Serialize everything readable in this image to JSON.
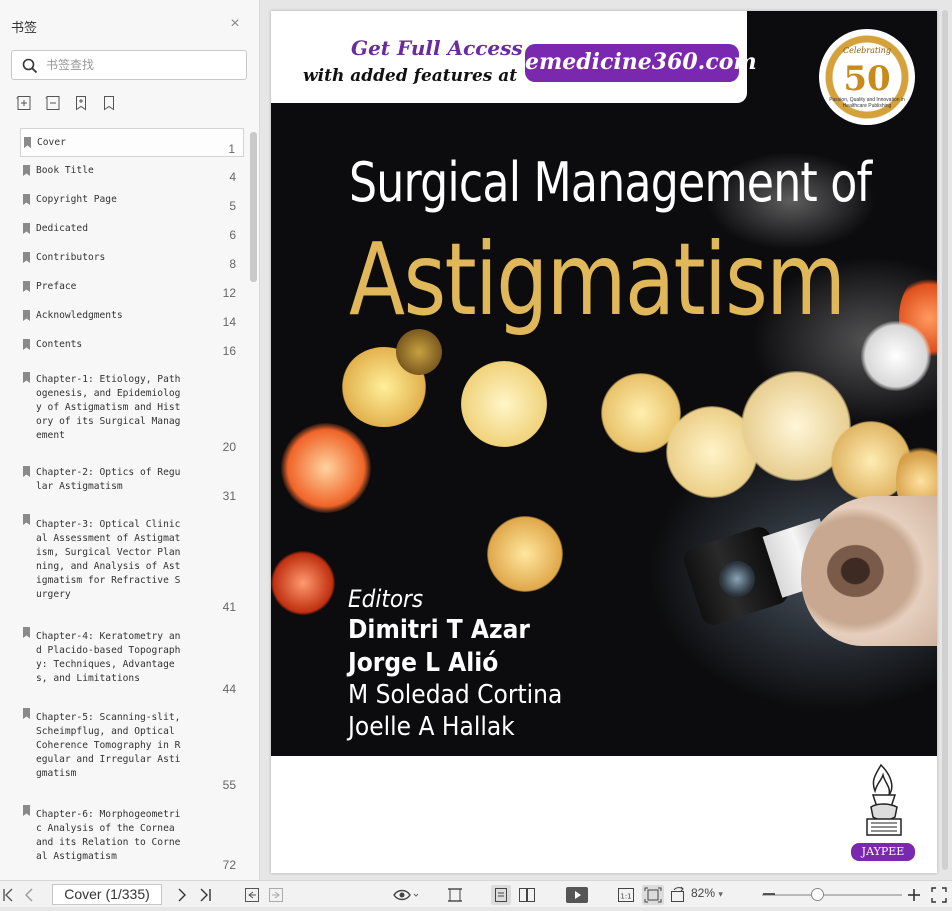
{
  "sidebar": {
    "title": "书签",
    "search_placeholder": "书签查找",
    "bookmarks": [
      {
        "label": "Cover",
        "page": "1"
      },
      {
        "label": "Book Title",
        "page": "4"
      },
      {
        "label": "Copyright Page",
        "page": "5"
      },
      {
        "label": "Dedicated",
        "page": "6"
      },
      {
        "label": "Contributors",
        "page": "8"
      },
      {
        "label": "Preface",
        "page": "12"
      },
      {
        "label": "Acknowledgments",
        "page": "14"
      },
      {
        "label": "Contents",
        "page": "16"
      },
      {
        "label": "Chapter-1: Etiology, Pathogenesis, and Epidemiology of Astigmatism and History of its Surgical Management",
        "page": "20"
      },
      {
        "label": "Chapter-2: Optics of Regular Astigmatism",
        "page": "31"
      },
      {
        "label": "Chapter-3: Optical Clinical Assessment of Astigmatism, Surgical Vector Planning, and Analysis of Astigmatism for Refractive Surgery",
        "page": "41"
      },
      {
        "label": "Chapter-4: Keratometry and Placido-based Topography: Techniques, Advantages, and Limitations",
        "page": "44"
      },
      {
        "label": "Chapter-5: Scanning-slit, Scheimpflug, and Optical Coherence Tomography in Regular and Irregular Astigmatism",
        "page": "55"
      },
      {
        "label": "Chapter-6: Morphogeometric Analysis of the Cornea and its Relation to Corneal Astigmatism",
        "page": "72"
      }
    ]
  },
  "cover": {
    "banner_line1": "Get Full Access",
    "banner_line2": "with added features at",
    "banner_site": "emedicine360.com",
    "seal_top": "Celebrating",
    "seal_number": "50",
    "seal_bottom": "Passion, Quality and Innovation in Healthcare Publishing",
    "title_line1": "Surgical Management of",
    "title_line2": "Astigmatism",
    "editors_label": "Editors",
    "editors": [
      "Dimitri T Azar",
      "Jorge L Alió",
      "M Soledad Cortina",
      "Joelle A Hallak"
    ],
    "publisher": "JAYPEE",
    "title_color": "#e0b85a",
    "accent_purple": "#7a28b0"
  },
  "toolbar": {
    "page_indicator": "Cover (1/335)",
    "zoom": "82%"
  }
}
